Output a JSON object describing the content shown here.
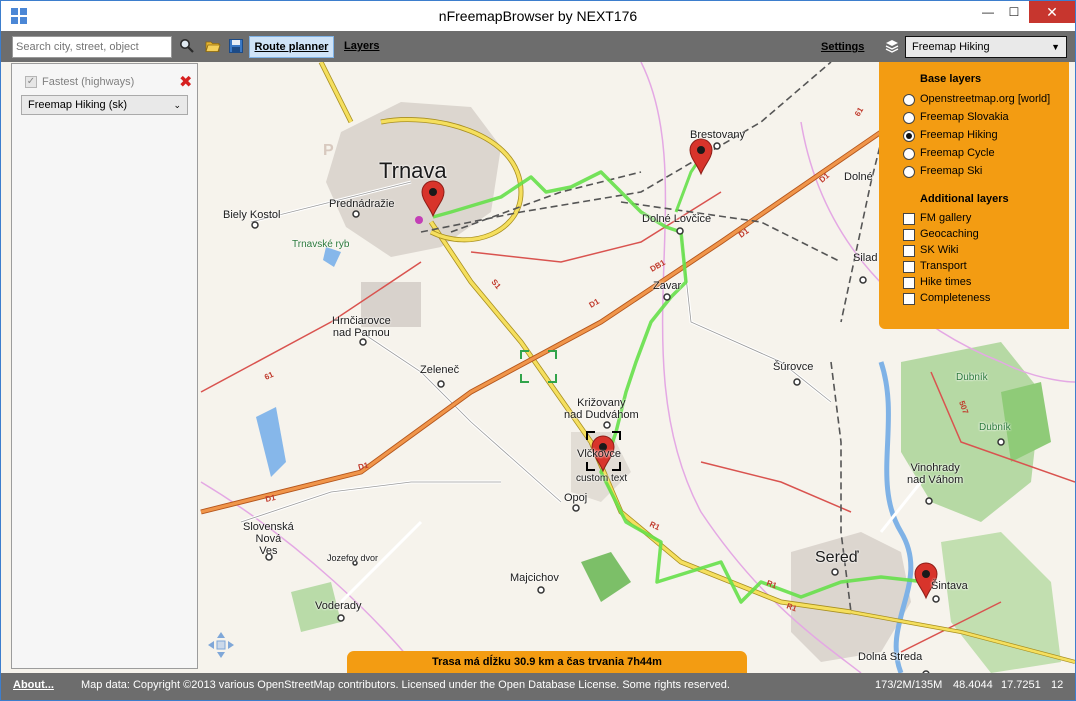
{
  "window": {
    "title": "nFreemapBrowser by NEXT176",
    "minimize_glyph": "—",
    "maximize_glyph": "☐",
    "close_glyph": "✕"
  },
  "toolbar": {
    "search_placeholder": "Search city, street, object",
    "search_icon": "search-icon",
    "open_icon": "folder-icon",
    "save_icon": "save-icon",
    "route_planner_label": "Route planner",
    "layers_label": "Layers",
    "settings_label": "Settings",
    "map_select_value": "Freemap Hiking"
  },
  "route_panel": {
    "fastest_label": "Fastest (highways)",
    "fastest_checked": true,
    "map_select_value": "Freemap Hiking (sk)"
  },
  "layers_panel": {
    "base_title": "Base layers",
    "base_layers": [
      {
        "label": "Openstreetmap.org [world]",
        "selected": false
      },
      {
        "label": "Freemap Slovakia",
        "selected": false
      },
      {
        "label": "Freemap Hiking",
        "selected": true
      },
      {
        "label": "Freemap Cycle",
        "selected": false
      },
      {
        "label": "Freemap Ski",
        "selected": false
      }
    ],
    "additional_title": "Additional layers",
    "additional_layers": [
      {
        "label": "FM gallery",
        "checked": false
      },
      {
        "label": "Geocaching",
        "checked": false
      },
      {
        "label": "SK Wiki",
        "checked": false
      },
      {
        "label": "Transport",
        "checked": false
      },
      {
        "label": "Hike times",
        "checked": false
      },
      {
        "label": "Completeness",
        "checked": false
      }
    ]
  },
  "map": {
    "places": {
      "trnava": "Trnava",
      "brestovany": "Brestovany",
      "biely_kostol": "Biely Kostol",
      "prednadrazie": "Prednádražie",
      "trnavske_ryb": "Trnavské ryb",
      "dolne_lovcice": "Dolné Lovčice",
      "zavar": "Zavar",
      "hrnciarovce": "Hrnčiarovce\nnad Parnou",
      "zelenec": "Zeleneč",
      "krizovany": "Križovany\nnad Dudváhom",
      "vlckovce": "Vlčkovce",
      "custom_text": "custom text",
      "opoj": "Opoj",
      "slovenska_nova_ves": "Slovenská\nNová\nVes",
      "jozefov_dvor": "Jozefov dvor",
      "majcichov": "Majcichov",
      "voderady": "Voderady",
      "sered": "Sereď",
      "vinohrady": "Vinohrady\nnad Váhom",
      "surovce": "Šúrovce",
      "dubnik": "Dubník",
      "dubnik2": "Dubník",
      "dolna_streda": "Dolná Streda",
      "siladice": "Silad",
      "dolne": "Dolné",
      "sintava": "Šintava"
    },
    "roads": {
      "d1": "D1",
      "db1": "DB1",
      "r1": "R1",
      "s1": "S1",
      "n61": "61",
      "n51": "51",
      "n507": "507"
    }
  },
  "route_info": "Trasa má dĺžku 30.9 km a čas trvania 7h44m",
  "statusbar": {
    "about_label": "About...",
    "copyright": "Map data: Copyright ©2013 various OpenStreetMap contributors. Licensed under the Open Database License. Some rights reserved.",
    "tile_info": "173/2M/135M",
    "latitude": "48.4044",
    "longitude": "17.7251",
    "zoom": "12"
  },
  "colors": {
    "accent_orange": "#f39c12",
    "toolbar_gray": "#6d6d6d",
    "route_green": "#66e04a",
    "marker_red": "#d8342b",
    "motorway_orange": "#e8883a"
  }
}
